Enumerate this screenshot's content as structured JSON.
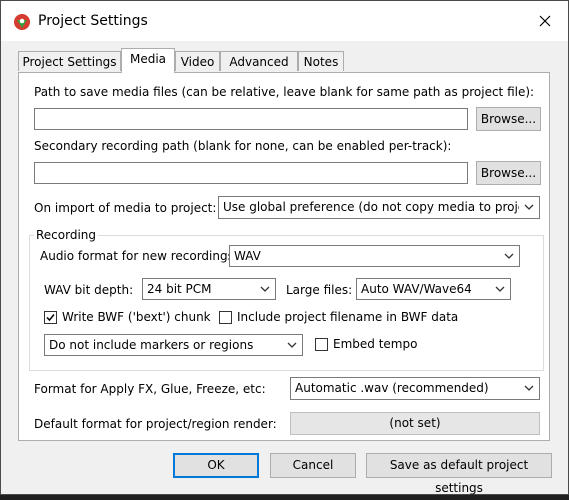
{
  "window": {
    "title": "Project Settings",
    "close_glyph": "✕"
  },
  "tabs": [
    {
      "label": "Project Settings"
    },
    {
      "label": "Media"
    },
    {
      "label": "Video"
    },
    {
      "label": "Advanced"
    },
    {
      "label": "Notes"
    }
  ],
  "active_tab": "Media",
  "media": {
    "path_label": "Path to save media files (can be relative, leave blank for same path as project file):",
    "path_value": "",
    "browse_label": "Browse...",
    "secondary_label": "Secondary recording path (blank for none, can be enabled per-track):",
    "secondary_value": "",
    "browse2_label": "Browse...",
    "import_label": "On import of media to project:",
    "import_value": "Use global preference (do not copy media to project",
    "recording": {
      "title": "Recording",
      "audio_format_label": "Audio format for new recordings:",
      "audio_format_value": "WAV",
      "bit_depth_label": "WAV bit depth:",
      "bit_depth_value": "24 bit PCM",
      "large_files_label": "Large files:",
      "large_files_value": "Auto WAV/Wave64",
      "write_bwf_label": "Write BWF ('bext') chunk",
      "write_bwf_checked": true,
      "include_filename_label": "Include project filename in BWF data",
      "include_filename_checked": false,
      "markers_value": "Do not include markers or regions",
      "embed_tempo_label": "Embed tempo",
      "embed_tempo_checked": false
    },
    "apply_fx_label": "Format for Apply FX, Glue, Freeze, etc:",
    "apply_fx_value": "Automatic .wav (recommended)",
    "render_label": "Default format for project/region render:",
    "render_value": "(not set)"
  },
  "footer": {
    "ok_label": "OK",
    "cancel_label": "Cancel",
    "save_default_label": "Save as default project settings"
  },
  "colors": {
    "accent": "#0078d7",
    "logo_red": "#d63b2f",
    "logo_green": "#3a9a3a"
  }
}
